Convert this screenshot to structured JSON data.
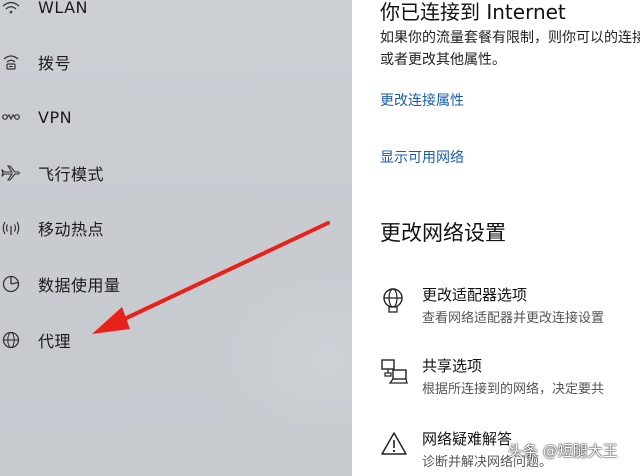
{
  "sidebar": {
    "items": [
      {
        "label": "WLAN",
        "icon": "wifi-icon"
      },
      {
        "label": "拨号",
        "icon": "dial-up-icon"
      },
      {
        "label": "VPN",
        "icon": "vpn-icon"
      },
      {
        "label": "飞行模式",
        "icon": "airplane-icon"
      },
      {
        "label": "移动热点",
        "icon": "hotspot-icon"
      },
      {
        "label": "数据使用量",
        "icon": "data-usage-icon"
      },
      {
        "label": "代理",
        "icon": "globe-icon"
      }
    ]
  },
  "status": {
    "title": "你已连接到 Internet",
    "description": "如果你的流量套餐有限制，则你可以的连接，或者更改其他属性。"
  },
  "links": {
    "change_connection_properties": "更改连接属性",
    "show_available_networks": "显示可用网络"
  },
  "network_settings": {
    "heading": "更改网络设置",
    "options": [
      {
        "title": "更改适配器选项",
        "description": "查看网络适配器并更改连接设置",
        "icon": "adapter-globe-icon"
      },
      {
        "title": "共享选项",
        "description": "根据所连接到的网络，决定要共",
        "icon": "sharing-icon"
      },
      {
        "title": "网络疑难解答",
        "description": "诊断并解决网络问题。",
        "icon": "warning-icon"
      }
    ]
  },
  "watermark": "头条 @短腿大王",
  "colors": {
    "accent_link": "#1a5dae",
    "arrow": "#e8221b",
    "sidebar_bg": "#c9cdd2"
  }
}
